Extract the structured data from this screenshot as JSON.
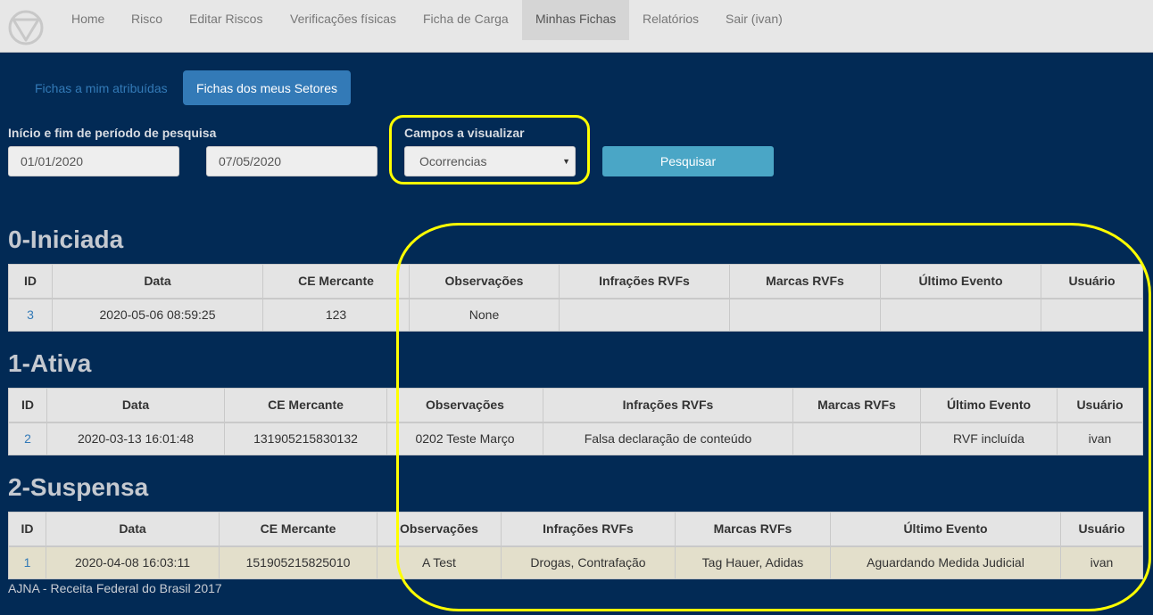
{
  "nav": {
    "items": [
      {
        "label": "Home"
      },
      {
        "label": "Risco"
      },
      {
        "label": "Editar Riscos"
      },
      {
        "label": "Verificações físicas"
      },
      {
        "label": "Ficha de Carga"
      },
      {
        "label": "Minhas Fichas",
        "active": true
      },
      {
        "label": "Relatórios"
      },
      {
        "label": "Sair (ivan)"
      }
    ]
  },
  "subtabs": {
    "assigned": "Fichas a mim atribuídas",
    "sectors": "Fichas dos meus Setores"
  },
  "filters": {
    "period_label": "Início e fim de período de pesquisa",
    "start_date": "01/01/2020",
    "end_date": "07/05/2020",
    "fields_label": "Campos a visualizar",
    "fields_selected": "Ocorrencias",
    "search_button": "Pesquisar"
  },
  "sections": [
    {
      "title": "0-Iniciada",
      "headers": [
        "ID",
        "Data",
        "CE Mercante",
        "Observações",
        "Infrações RVFs",
        "Marcas RVFs",
        "Último Evento",
        "Usuário"
      ],
      "rows": [
        [
          "3",
          "2020-05-06 08:59:25",
          "123",
          "None",
          "",
          "",
          "",
          ""
        ]
      ]
    },
    {
      "title": "1-Ativa",
      "headers": [
        "ID",
        "Data",
        "CE Mercante",
        "Observações",
        "Infrações RVFs",
        "Marcas RVFs",
        "Último Evento",
        "Usuário"
      ],
      "rows": [
        [
          "2",
          "2020-03-13 16:01:48",
          "131905215830132",
          "0202 Teste Março",
          "Falsa declaração de conteúdo",
          "",
          "RVF incluída",
          "ivan"
        ]
      ]
    },
    {
      "title": "2-Suspensa",
      "headers": [
        "ID",
        "Data",
        "CE Mercante",
        "Observações",
        "Infrações RVFs",
        "Marcas RVFs",
        "Último Evento",
        "Usuário"
      ],
      "rows": [
        [
          "1",
          "2020-04-08 16:03:11",
          "151905215825010",
          "A Test",
          "Drogas, Contrafação",
          "Tag Hauer, Adidas",
          "Aguardando Medida Judicial",
          "ivan"
        ]
      ]
    }
  ],
  "footer": "AJNA - Receita Federal do Brasil 2017",
  "colors": {
    "page_bg": "#022a55",
    "navbar_bg": "#e7e7e7",
    "primary": "#337ab7",
    "search_button": "#4aa6c6",
    "annotation": "#ffff00",
    "warning_row": "#e3dfcb"
  }
}
